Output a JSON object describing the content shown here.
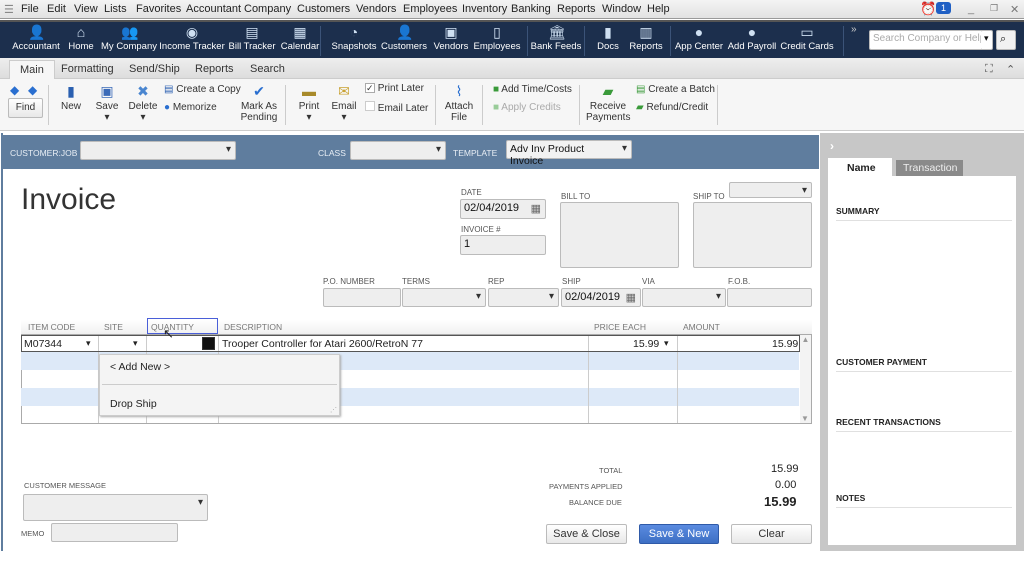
{
  "menu": [
    "File",
    "Edit",
    "View",
    "Lists",
    "Favorites",
    "Accountant",
    "Company",
    "Customers",
    "Vendors",
    "Employees",
    "Inventory",
    "Banking",
    "Reports",
    "Window",
    "Help"
  ],
  "notification_count": "1",
  "iconbar": [
    {
      "label": "Accountant",
      "icon": "accountant-icon"
    },
    {
      "label": "Home",
      "icon": "home-icon"
    },
    {
      "label": "My Company",
      "icon": "company-icon"
    },
    {
      "label": "Income Tracker",
      "icon": "income-tracker-icon"
    },
    {
      "label": "Bill Tracker",
      "icon": "bill-tracker-icon"
    },
    {
      "label": "Calendar",
      "icon": "calendar-icon"
    },
    {
      "label": "Snapshots",
      "icon": "pie-chart-icon"
    },
    {
      "label": "Customers",
      "icon": "customer-icon"
    },
    {
      "label": "Vendors",
      "icon": "vendor-icon"
    },
    {
      "label": "Employees",
      "icon": "employee-icon"
    },
    {
      "label": "Bank Feeds",
      "icon": "bank-icon"
    },
    {
      "label": "Docs",
      "icon": "document-icon"
    },
    {
      "label": "Reports",
      "icon": "report-icon"
    },
    {
      "label": "App Center",
      "icon": "app-center-icon"
    },
    {
      "label": "Add Payroll",
      "icon": "payroll-icon"
    },
    {
      "label": "Credit Cards",
      "icon": "credit-card-icon"
    }
  ],
  "search": {
    "placeholder": "Search Company or Help"
  },
  "tabs": [
    "Main",
    "Formatting",
    "Send/Ship",
    "Reports",
    "Search"
  ],
  "ribbon": {
    "find": "Find",
    "new": "New",
    "save": "Save",
    "delete": "Delete",
    "create_copy": "Create a Copy",
    "memorize": "Memorize",
    "mark_pending": "Mark As Pending",
    "print": "Print",
    "email": "Email",
    "print_later": "Print Later",
    "print_later_checked": true,
    "email_later": "Email Later",
    "email_later_checked": false,
    "attach": "Attach File",
    "add_time": "Add Time/Costs",
    "apply_credits": "Apply Credits",
    "receive_payments": "Receive Payments",
    "create_batch": "Create a Batch",
    "refund_credit": "Refund/Credit"
  },
  "header": {
    "customer_job_label": "CUSTOMER:JOB",
    "customer_job": "",
    "class_label": "CLASS",
    "class": "",
    "template_label": "TEMPLATE",
    "template": "Adv Inv Product Invoice"
  },
  "invoice": {
    "title": "Invoice",
    "date_label": "DATE",
    "date": "02/04/2019",
    "invoice_no_label": "INVOICE #",
    "invoice_no": "1",
    "bill_to_label": "BILL TO",
    "ship_to_label": "SHIP TO",
    "po_label": "P.O. NUMBER",
    "terms_label": "TERMS",
    "rep_label": "REP",
    "ship_label": "SHIP",
    "ship_date": "02/04/2019",
    "via_label": "VIA",
    "fob_label": "F.O.B."
  },
  "columns": [
    "ITEM CODE",
    "SITE",
    "QUANTITY",
    "DESCRIPTION",
    "PRICE EACH",
    "AMOUNT"
  ],
  "line_items": [
    {
      "item_code": "M07344",
      "site": "",
      "quantity": "",
      "description": "Trooper Controller for Atari 2600/RetroN 77",
      "price": "15.99",
      "amount": "15.99"
    }
  ],
  "site_dropdown": [
    "< Add New >",
    "Drop Ship"
  ],
  "totals": {
    "total_label": "TOTAL",
    "total": "15.99",
    "payments_label": "PAYMENTS APPLIED",
    "payments": "0.00",
    "balance_label": "BALANCE DUE",
    "balance": "15.99"
  },
  "footer": {
    "customer_message_label": "CUSTOMER MESSAGE",
    "memo_label": "MEMO",
    "save_close": "Save & Close",
    "save_new": "Save & New",
    "clear": "Clear"
  },
  "side_panel": {
    "tabs": [
      "Name",
      "Transaction"
    ],
    "sections": [
      "SUMMARY",
      "CUSTOMER PAYMENT",
      "RECENT TRANSACTIONS",
      "NOTES"
    ]
  },
  "colors": {
    "iconbar": "#1c2f4d",
    "header_bar": "#5f7d9e",
    "primary_button": "#3d6fc4",
    "row_stripe": "#dde9f8"
  }
}
